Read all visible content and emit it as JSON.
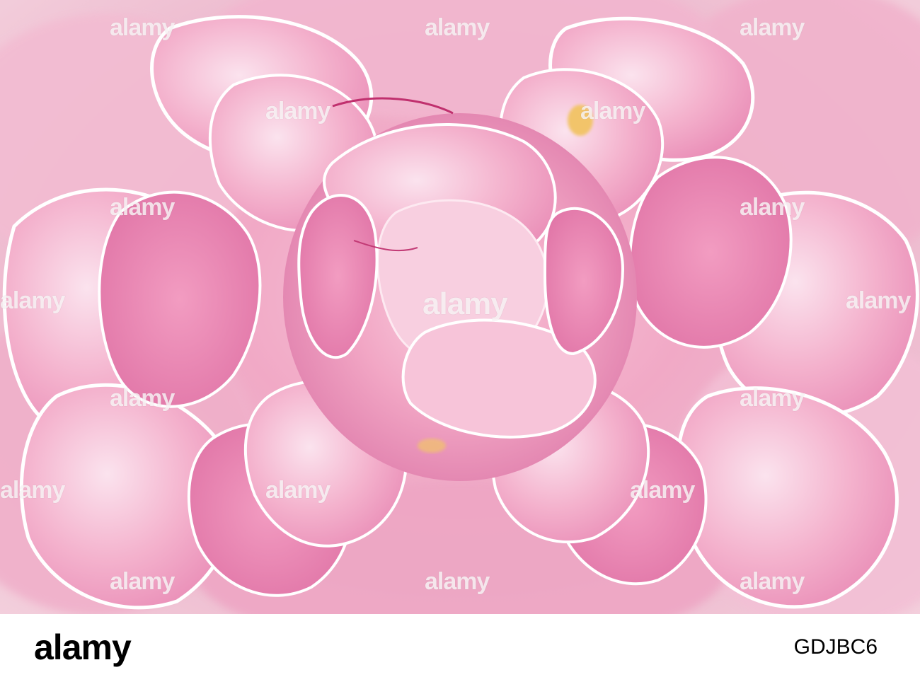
{
  "image": {
    "description_colors": {
      "petal_light": "#fbe6ef",
      "petal_mid": "#f2a8c6",
      "petal_deep": "#e07aa8",
      "petal_edge": "#ffffff"
    }
  },
  "watermark": {
    "text": "alamy"
  },
  "footer": {
    "logo": "alamy",
    "image_id": "GDJBC6"
  }
}
